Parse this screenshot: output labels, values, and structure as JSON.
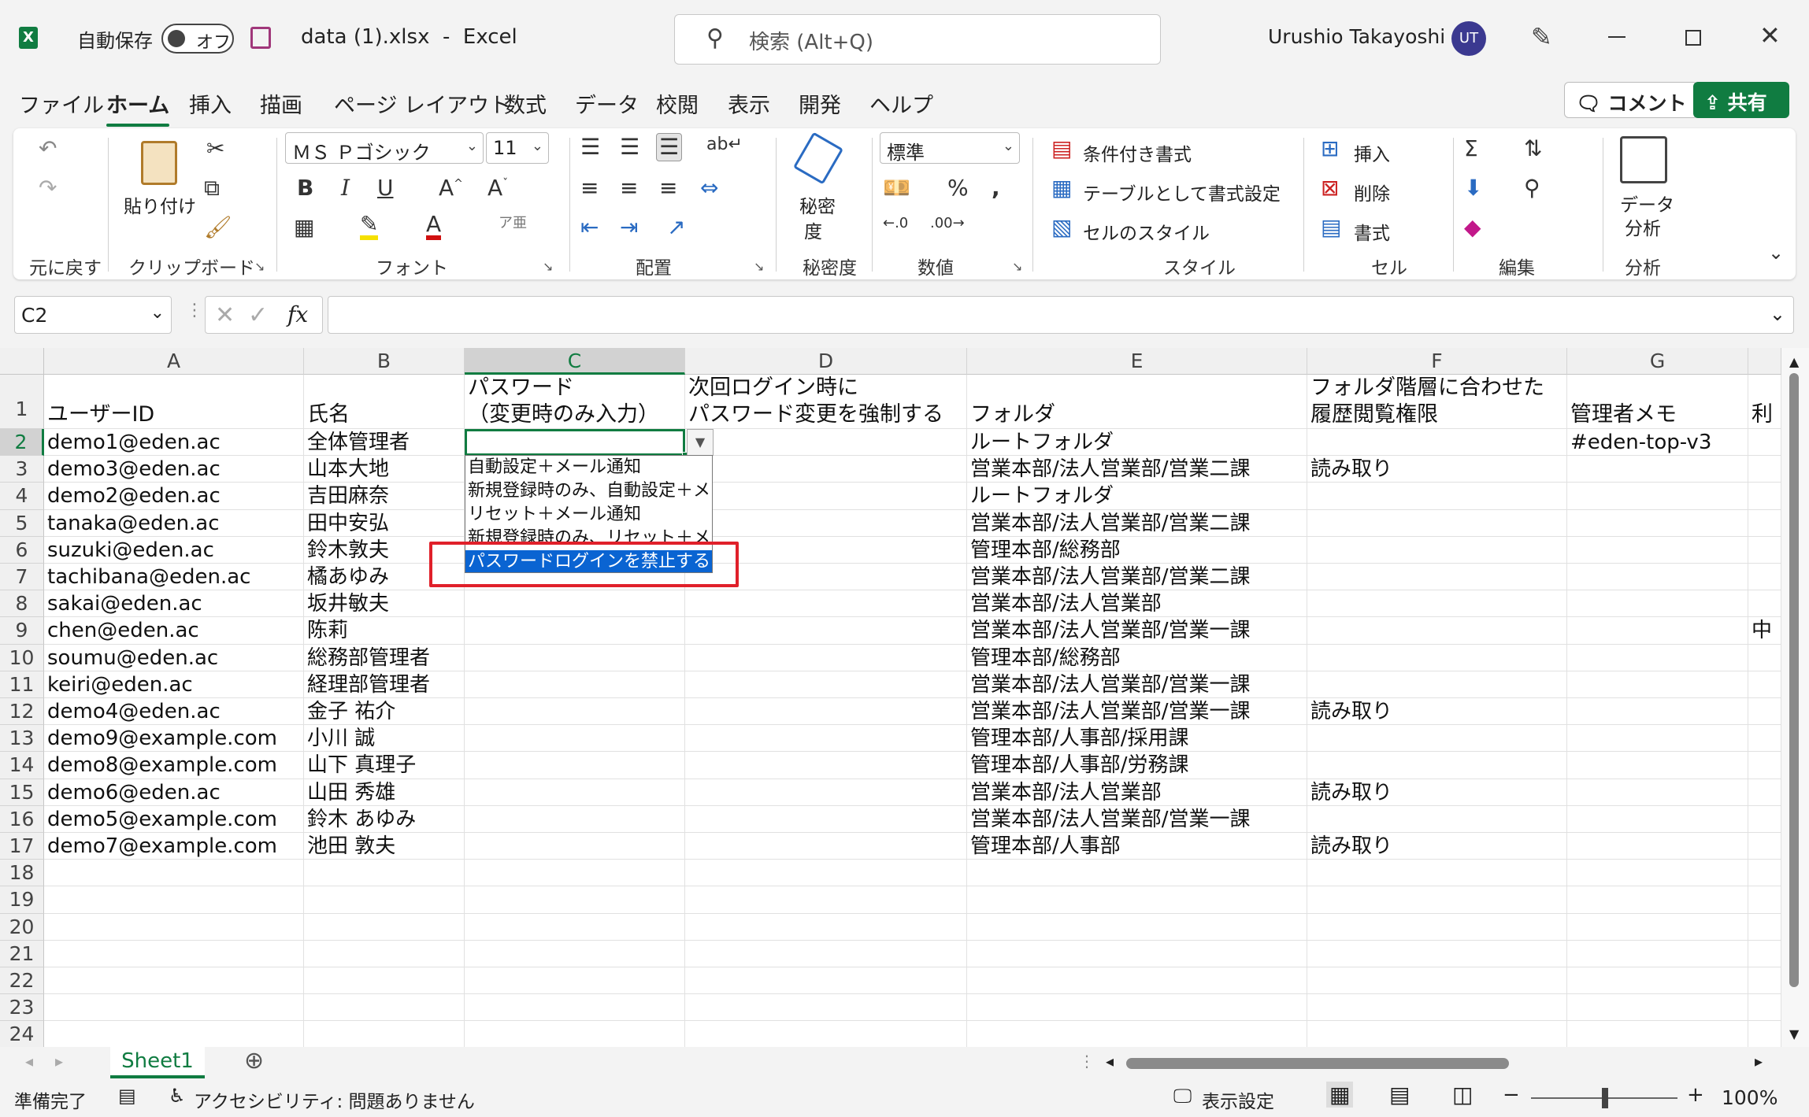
{
  "titlebar": {
    "autosave_label": "自動保存",
    "autosave_state": "オフ",
    "filename": "data (1).xlsx  -  Excel",
    "search_placeholder": "検索 (Alt+Q)",
    "user_name": "Urushio Takayoshi",
    "user_initials": "UT"
  },
  "tabs": [
    "ファイル",
    "ホーム",
    "挿入",
    "描画",
    "ページ レイアウト",
    "数式",
    "データ",
    "校閲",
    "表示",
    "開発",
    "ヘルプ"
  ],
  "active_tab": "ホーム",
  "share": {
    "comment_label": "コメント",
    "share_label": "共有"
  },
  "ribbon": {
    "undo_group": "元に戻す",
    "clipboard": {
      "label": "クリップボード",
      "paste": "貼り付け"
    },
    "font": {
      "label": "フォント",
      "family": "ＭＳ Ｐゴシック",
      "size": "11",
      "bold": "B",
      "italic": "I",
      "underline": "U"
    },
    "alignment": {
      "label": "配置"
    },
    "sensitivity": {
      "label": "秘密度",
      "button_line1": "秘密",
      "button_line2": "度"
    },
    "number": {
      "label": "数値",
      "format": "標準"
    },
    "styles": {
      "label": "スタイル",
      "conditional": "条件付き書式",
      "table": "テーブルとして書式設定",
      "cell_styles": "セルのスタイル"
    },
    "cells": {
      "label": "セル",
      "insert": "挿入",
      "delete": "削除",
      "format": "書式"
    },
    "editing": {
      "label": "編集"
    },
    "analysis": {
      "label": "分析",
      "button_line1": "データ",
      "button_line2": "分析"
    }
  },
  "formula_bar": {
    "name_box": "C2",
    "fx": "fx",
    "formula": ""
  },
  "columns": [
    "A",
    "B",
    "C",
    "D",
    "E",
    "F",
    "G"
  ],
  "selected_column": "C",
  "header_row": {
    "A": "ユーザーID",
    "B": "氏名",
    "C1": "パスワード",
    "C2": "（変更時のみ入力）",
    "D1": "次回ログイン時に",
    "D2": "パスワード変更を強制する",
    "E": "フォルダ",
    "F1": "フォルダ階層に合わせた",
    "F2": "履歴閲覧権限",
    "G": "管理者メモ",
    "H": "利"
  },
  "rows": [
    {
      "num": "2",
      "A": "demo1@eden.ac",
      "B": "全体管理者",
      "E": "ルートフォルダ",
      "F": "",
      "G": "#eden-top-v3",
      "H": ""
    },
    {
      "num": "3",
      "A": "demo3@eden.ac",
      "B": "山本大地",
      "E": "営業本部/法人営業部/営業二課",
      "F": "読み取り",
      "G": "",
      "H": ""
    },
    {
      "num": "4",
      "A": "demo2@eden.ac",
      "B": "吉田麻奈",
      "E": "ルートフォルダ",
      "F": "",
      "G": "",
      "H": ""
    },
    {
      "num": "5",
      "A": "tanaka@eden.ac",
      "B": "田中安弘",
      "E": "営業本部/法人営業部/営業二課",
      "F": "",
      "G": "",
      "H": ""
    },
    {
      "num": "6",
      "A": "suzuki@eden.ac",
      "B": "鈴木敦夫",
      "E": "管理本部/総務部",
      "F": "",
      "G": "",
      "H": ""
    },
    {
      "num": "7",
      "A": "tachibana@eden.ac",
      "B": "橘あゆみ",
      "E": "営業本部/法人営業部/営業二課",
      "F": "",
      "G": "",
      "H": ""
    },
    {
      "num": "8",
      "A": "sakai@eden.ac",
      "B": "坂井敏夫",
      "E": "営業本部/法人営業部",
      "F": "",
      "G": "",
      "H": ""
    },
    {
      "num": "9",
      "A": "chen@eden.ac",
      "B": "陈莉",
      "E": "営業本部/法人営業部/営業一課",
      "F": "",
      "G": "",
      "H": "中"
    },
    {
      "num": "10",
      "A": "soumu@eden.ac",
      "B": "総務部管理者",
      "E": "管理本部/総務部",
      "F": "",
      "G": "",
      "H": ""
    },
    {
      "num": "11",
      "A": "keiri@eden.ac",
      "B": "経理部管理者",
      "E": "営業本部/法人営業部/営業一課",
      "F": "",
      "G": "",
      "H": ""
    },
    {
      "num": "12",
      "A": "demo4@eden.ac",
      "B": "金子 祐介",
      "E": "営業本部/法人営業部/営業一課",
      "F": "読み取り",
      "G": "",
      "H": ""
    },
    {
      "num": "13",
      "A": "demo9@example.com",
      "B": "小川 誠",
      "E": "管理本部/人事部/採用課",
      "F": "",
      "G": "",
      "H": ""
    },
    {
      "num": "14",
      "A": "demo8@example.com",
      "B": "山下 真理子",
      "E": "管理本部/人事部/労務課",
      "F": "",
      "G": "",
      "H": ""
    },
    {
      "num": "15",
      "A": "demo6@eden.ac",
      "B": "山田 秀雄",
      "E": "営業本部/法人営業部",
      "F": "読み取り",
      "G": "",
      "H": ""
    },
    {
      "num": "16",
      "A": "demo5@example.com",
      "B": "鈴木 あゆみ",
      "E": "営業本部/法人営業部/営業一課",
      "F": "",
      "G": "",
      "H": ""
    },
    {
      "num": "17",
      "A": "demo7@example.com",
      "B": "池田 敦夫",
      "E": "管理本部/人事部",
      "F": "読み取り",
      "G": "",
      "H": ""
    },
    {
      "num": "18",
      "A": "",
      "B": "",
      "E": "",
      "F": "",
      "G": "",
      "H": ""
    },
    {
      "num": "19",
      "A": "",
      "B": "",
      "E": "",
      "F": "",
      "G": "",
      "H": ""
    },
    {
      "num": "20",
      "A": "",
      "B": "",
      "E": "",
      "F": "",
      "G": "",
      "H": ""
    },
    {
      "num": "21",
      "A": "",
      "B": "",
      "E": "",
      "F": "",
      "G": "",
      "H": ""
    },
    {
      "num": "22",
      "A": "",
      "B": "",
      "E": "",
      "F": "",
      "G": "",
      "H": ""
    },
    {
      "num": "23",
      "A": "",
      "B": "",
      "E": "",
      "F": "",
      "G": "",
      "H": ""
    },
    {
      "num": "24",
      "A": "",
      "B": "",
      "E": "",
      "F": "",
      "G": "",
      "H": ""
    }
  ],
  "dropdown_options": [
    "自動設定＋メール通知",
    "新規登録時のみ、自動設定＋メ",
    "リセット＋メール通知",
    "新規登録時のみ、リセット＋メー",
    "パスワードログインを禁止する"
  ],
  "dropdown_highlighted_index": 4,
  "sheet_tab": "Sheet1",
  "status": {
    "ready": "準備完了",
    "accessibility": "アクセシビリティ: 問題ありません",
    "display_settings": "表示設定",
    "zoom": "100%"
  },
  "colors": {
    "excel_green": "#107c41",
    "highlight_blue": "#0a64d2",
    "annotation_red": "#e0202a",
    "avatar": "#3b3990"
  }
}
